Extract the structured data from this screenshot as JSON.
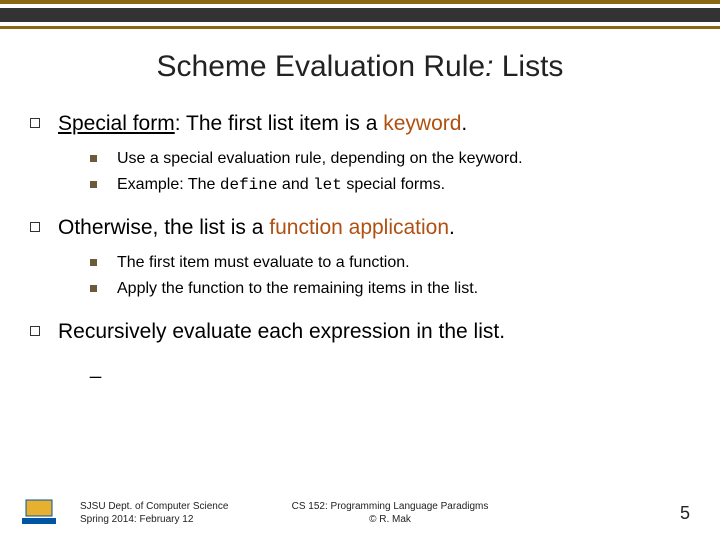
{
  "title": {
    "pre": "Scheme Evaluation Rule",
    "sep": ": ",
    "post": "Lists"
  },
  "bullets": [
    {
      "pre": "Special form",
      "plain": ": The first list item is a ",
      "keyword": "keyword",
      "post": ".",
      "sub": [
        {
          "text": "Use a special evaluation rule, depending on the keyword."
        },
        {
          "pre": "Example: The ",
          "code1": "define",
          "mid": " and ",
          "code2": "let",
          "post": " special forms."
        }
      ]
    },
    {
      "plain": "Otherwise, the list is a ",
      "fn": "function application",
      "post": ".",
      "sub": [
        {
          "text": "The first item must evaluate to a function."
        },
        {
          "text": "Apply the function to the remaining items in the list."
        }
      ]
    },
    {
      "plain": "Recursively evaluate each expression in the list.",
      "dash": "_"
    }
  ],
  "footer": {
    "dept1": "SJSU Dept. of Computer Science",
    "dept2": "Spring 2014: February 12",
    "course1": "CS 152: Programming Language Paradigms",
    "course2": "© R. Mak",
    "page": "5"
  }
}
